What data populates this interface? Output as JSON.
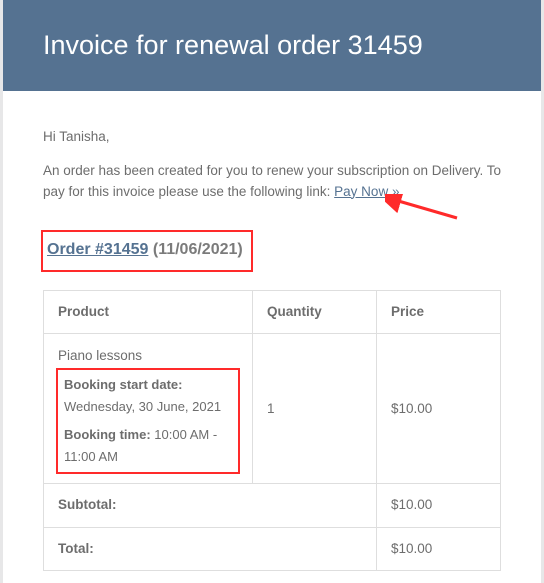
{
  "header": {
    "title": "Invoice for renewal order 31459"
  },
  "body": {
    "greeting": "Hi Tanisha,",
    "intro_before_link": "An order has been created for you to renew your subscription on Delivery. To pay for this invoice please use the following link: ",
    "pay_link_text": "Pay Now »",
    "order_link_text": "Order #31459",
    "order_date_text": "(11/06/2021)"
  },
  "table": {
    "headers": {
      "product": "Product",
      "quantity": "Quantity",
      "price": "Price"
    },
    "row": {
      "product_name": "Piano lessons",
      "booking_date_label": "Booking start date:",
      "booking_date_value": " Wednesday, 30 June, 2021",
      "booking_time_label": "Booking time:",
      "booking_time_value": " 10:00 AM - 11:00 AM",
      "quantity": "1",
      "price": "$10.00"
    },
    "subtotal_label": "Subtotal:",
    "subtotal_value": "$10.00",
    "total_label": "Total:",
    "total_value": "$10.00"
  }
}
